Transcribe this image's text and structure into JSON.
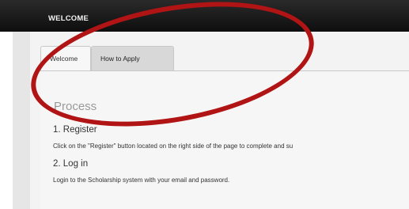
{
  "header": {
    "title": "WELCOME"
  },
  "tabs": [
    {
      "label": "Welcome"
    },
    {
      "label": "How to Apply"
    }
  ],
  "content": {
    "section_title": "Process",
    "steps": [
      {
        "heading": "1. Register",
        "text": "Click on the \"Register\" button located on the right side of the page to complete and su"
      },
      {
        "heading": "2. Log in",
        "text": "Login to the Scholarship system with your email and password."
      }
    ]
  },
  "annotation": {
    "color": "#b11414"
  }
}
